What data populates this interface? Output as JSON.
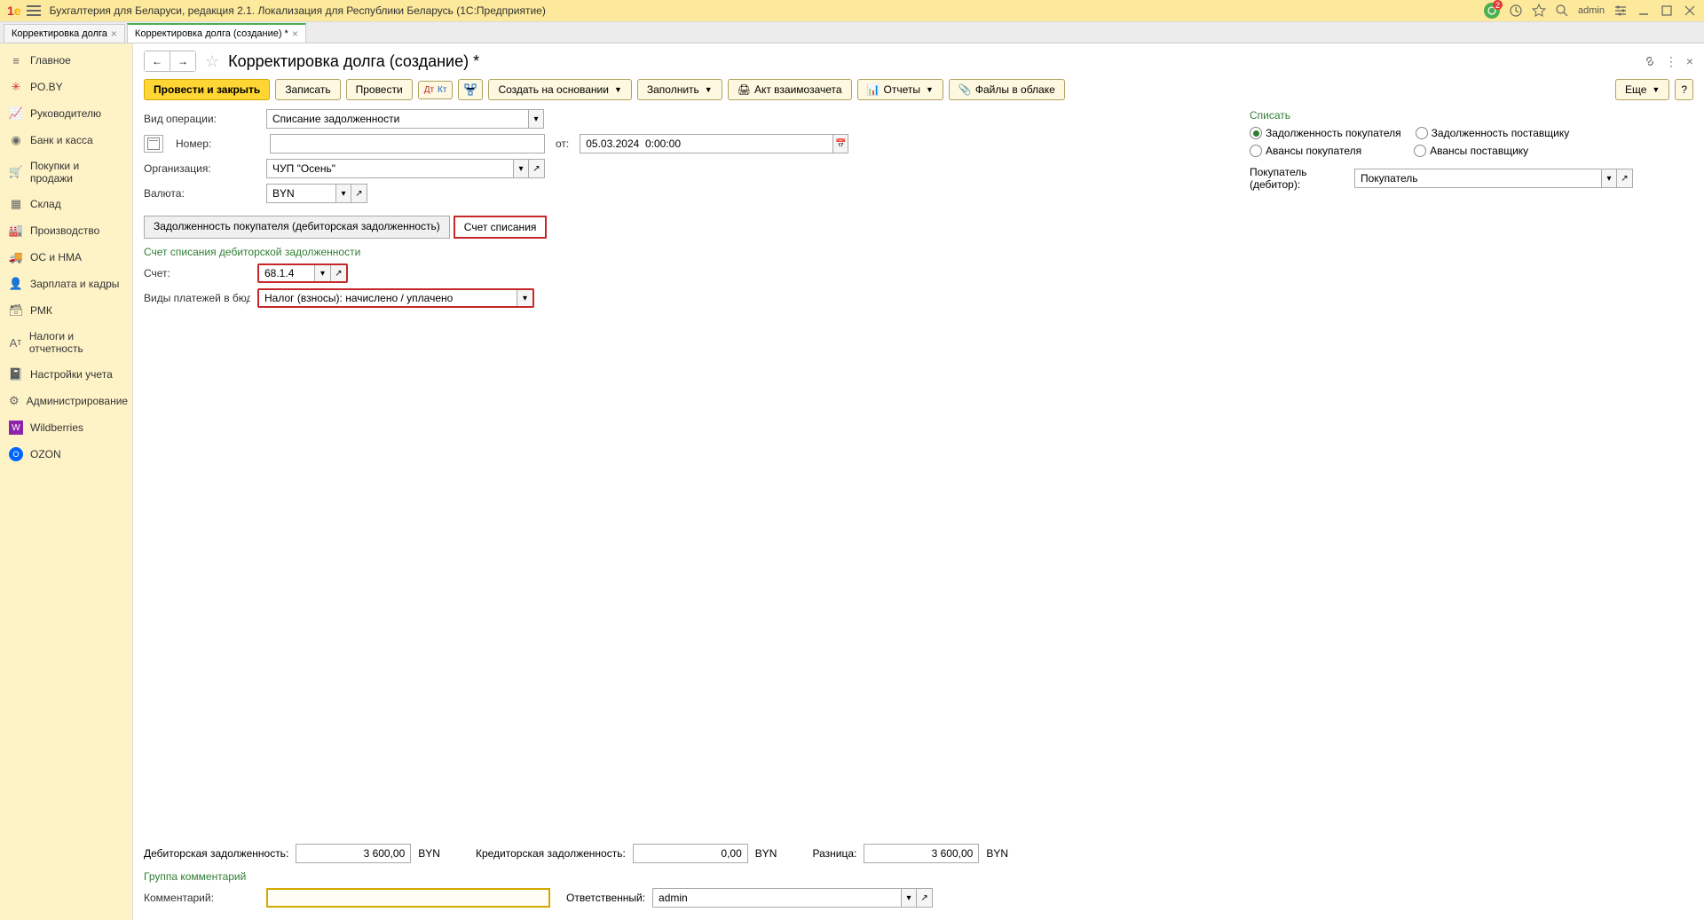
{
  "app": {
    "title": "Бухгалтерия для Беларуси, редакция 2.1. Локализация для Республики Беларусь   (1С:Предприятие)"
  },
  "topbar": {
    "notif_count": "2",
    "user": "admin"
  },
  "tabs": [
    {
      "label": "Корректировка долга"
    },
    {
      "label": "Корректировка долга (создание) *"
    }
  ],
  "sidebar": {
    "items": [
      "Главное",
      "PO.BY",
      "Руководителю",
      "Банк и касса",
      "Покупки и продажи",
      "Склад",
      "Производство",
      "ОС и НМА",
      "Зарплата и кадры",
      "РМК",
      "Налоги и отчетность",
      "Настройки учета",
      "Администрирование",
      "Wildberries",
      "OZON"
    ]
  },
  "page": {
    "title": "Корректировка долга (создание) *"
  },
  "toolbar": {
    "post_close": "Провести и закрыть",
    "record": "Записать",
    "post": "Провести",
    "create_based": "Создать на основании",
    "fill": "Заполнить",
    "act": "Акт взаимозачета",
    "reports": "Отчеты",
    "files": "Файлы в облаке",
    "more": "Еще",
    "help": "?"
  },
  "form": {
    "op_label": "Вид операции:",
    "op_value": "Списание задолженности",
    "num_label": "Номер:",
    "num_value": "",
    "from_label": "от:",
    "date_value": "05.03.2024  0:00:00",
    "org_label": "Организация:",
    "org_value": "ЧУП \"Осень\"",
    "cur_label": "Валюта:",
    "cur_value": "BYN"
  },
  "writeoff": {
    "title": "Списать",
    "opts": [
      "Задолженность покупателя",
      "Задолженность поставщику",
      "Авансы покупателя",
      "Авансы поставщику"
    ],
    "buyer_label": "Покупатель (дебитор):",
    "buyer_value": "Покупатель"
  },
  "subtabs": {
    "t1": "Задолженность покупателя (дебиторская задолженность)",
    "t2": "Счет списания"
  },
  "account": {
    "section": "Счет списания дебиторской задолженности",
    "acc_label": "Счет:",
    "acc_value": "68.1.4",
    "pay_label": "Виды платежей в бюд...",
    "pay_value": "Налог (взносы): начислено / уплачено"
  },
  "totals": {
    "deb_label": "Дебиторская задолженность:",
    "deb_value": "3 600,00",
    "deb_cur": "BYN",
    "cred_label": "Кредиторская задолженность:",
    "cred_value": "0,00",
    "cred_cur": "BYN",
    "diff_label": "Разница:",
    "diff_value": "3 600,00",
    "diff_cur": "BYN"
  },
  "comments": {
    "group": "Группа комментарий",
    "comm_label": "Комментарий:",
    "comm_value": "",
    "resp_label": "Ответственный:",
    "resp_value": "admin"
  }
}
